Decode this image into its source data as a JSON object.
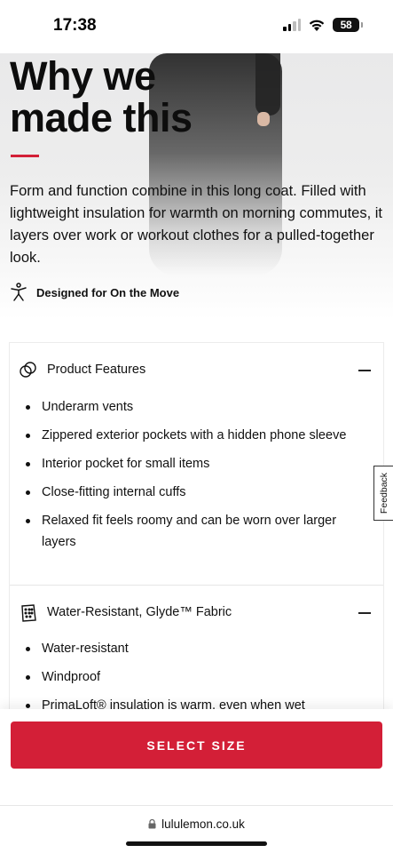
{
  "status_bar": {
    "time": "17:38",
    "battery": "58"
  },
  "hero": {
    "title_line1": "Why we",
    "title_line2": "made this",
    "accent_color": "#d31f37",
    "description": "Form and function combine in this long coat. Filled with lightweight insulation for warmth on morning commutes, it layers over work or workout clothes for a pulled-together look.",
    "designed_for": "Designed for On the Move",
    "designed_icon": "person-activity-icon"
  },
  "accordion": {
    "sections": [
      {
        "title": "Product Features",
        "icon": "features-icon",
        "expanded": true,
        "items": [
          "Underarm vents",
          "Zippered exterior pockets with a hidden phone sleeve",
          "Interior pocket for small items",
          "Close-fitting internal cuffs",
          "Relaxed fit feels roomy and can be worn over larger layers"
        ]
      },
      {
        "title": "Water-Resistant, Glyde™ Fabric",
        "icon": "fabric-icon",
        "expanded": true,
        "items": [
          "Water-resistant",
          "Windproof",
          "PrimaLoft® insulation is warm, even when wet"
        ]
      }
    ]
  },
  "feedback_tab": "Feedback",
  "cta": {
    "select_size": "SELECT SIZE",
    "color": "#d31f37"
  },
  "browser": {
    "url": "lululemon.co.uk"
  }
}
